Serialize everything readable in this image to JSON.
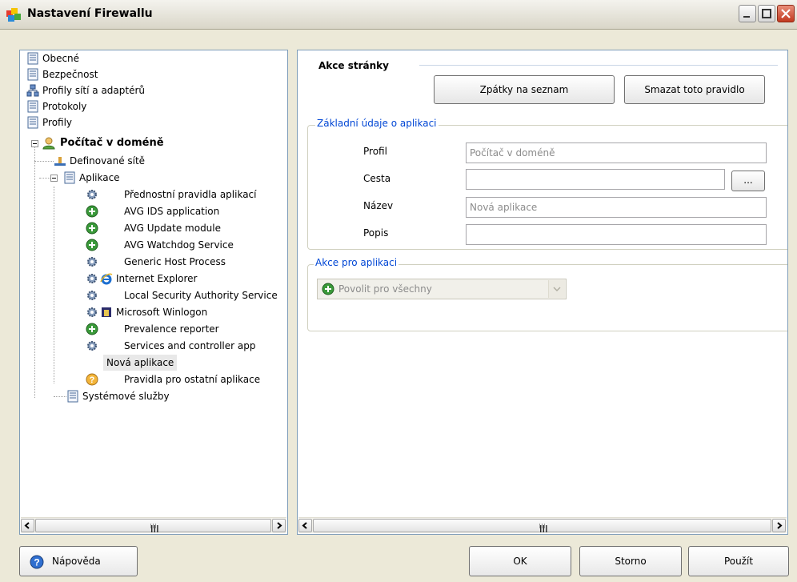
{
  "window": {
    "title": "Nastavení Firewallu"
  },
  "tree": {
    "items": [
      {
        "label": "Obecné"
      },
      {
        "label": "Bezpečnost"
      },
      {
        "label": "Profily sítí a adaptérů"
      },
      {
        "label": "Protokoly"
      },
      {
        "label": "Profily"
      },
      {
        "label": "Počítač v doméně"
      },
      {
        "label": "Definované sítě"
      },
      {
        "label": "Aplikace"
      },
      {
        "label": "Přednostní pravidla aplikací"
      },
      {
        "label": "AVG IDS application"
      },
      {
        "label": "AVG Update module"
      },
      {
        "label": "AVG Watchdog Service"
      },
      {
        "label": "Generic Host Process"
      },
      {
        "label": "Internet Explorer"
      },
      {
        "label": "Local Security Authority Service"
      },
      {
        "label": "Microsoft Winlogon"
      },
      {
        "label": "Prevalence reporter"
      },
      {
        "label": "Services and controller app"
      },
      {
        "label": "Nová aplikace"
      },
      {
        "label": "Pravidla pro ostatní aplikace"
      },
      {
        "label": "Systémové služby"
      }
    ]
  },
  "page_actions": {
    "title": "Akce stránky",
    "back_label": "Zpátky na seznam",
    "delete_label": "Smazat toto pravidlo"
  },
  "app_info": {
    "legend": "Základní údaje o aplikaci",
    "profile_label": "Profil",
    "profile_value": "Počítač v doméně",
    "path_label": "Cesta",
    "path_value": "",
    "browse_label": "...",
    "name_label": "Název",
    "name_value": "Nová aplikace",
    "desc_label": "Popis",
    "desc_value": ""
  },
  "app_action": {
    "legend": "Akce pro aplikaci",
    "selected": "Povolit pro všechny"
  },
  "scroll": {
    "left_grip": "III",
    "right_grip": "III"
  },
  "footer": {
    "help_label": "Nápověda",
    "ok_label": "OK",
    "cancel_label": "Storno",
    "apply_label": "Použít"
  },
  "colors": {
    "accent": "#0046d5",
    "allow_green": "#3a9a3a",
    "border": "#7f9db9"
  }
}
